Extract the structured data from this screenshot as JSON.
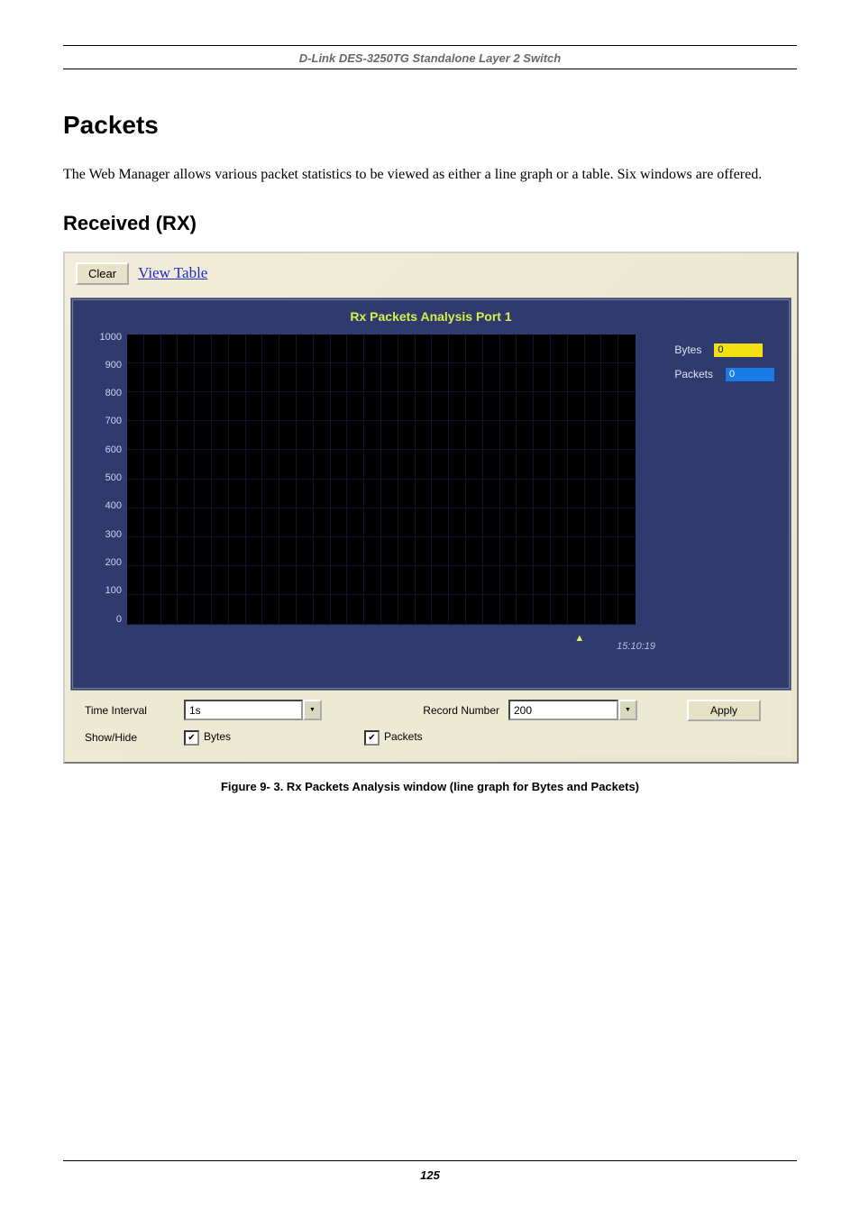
{
  "header": {
    "title": "D-Link DES-3250TG Standalone Layer 2 Switch"
  },
  "body": {
    "h1": "Packets",
    "intro": "The Web Manager allows various packet statistics to be viewed as either a line graph or a table. Six windows are offered.",
    "h2": "Received (RX)"
  },
  "screenshot": {
    "toolbar": {
      "clear_label": "Clear",
      "view_table_label": "View Table"
    },
    "chart_title": "Rx Packets Analysis   Port 1",
    "legend": {
      "bytes_label": "Bytes",
      "bytes_value": "0",
      "packets_label": "Packets",
      "packets_value": "0"
    },
    "time_label": "15:10:19",
    "controls": {
      "time_interval_label": "Time Interval",
      "time_interval_value": "1s",
      "record_number_label": "Record Number",
      "record_number_value": "200",
      "apply_label": "Apply",
      "show_hide_label": "Show/Hide",
      "bytes_cb_label": "Bytes",
      "packets_cb_label": "Packets"
    }
  },
  "caption": "Figure 9- 3.  Rx Packets Analysis window (line graph for Bytes and Packets)",
  "footer": {
    "page": "125"
  },
  "chart_data": {
    "type": "line",
    "title": "Rx Packets Analysis   Port 1",
    "ylabel": "",
    "xlabel": "",
    "ylim": [
      0,
      1000
    ],
    "y_ticks": [
      1000,
      900,
      800,
      700,
      600,
      500,
      400,
      300,
      200,
      100,
      0
    ],
    "x_time_marker": "15:10:19",
    "series": [
      {
        "name": "Bytes",
        "color": "#f2e011",
        "values": [
          0
        ]
      },
      {
        "name": "Packets",
        "color": "#1a7ae6",
        "values": [
          0
        ]
      }
    ]
  }
}
